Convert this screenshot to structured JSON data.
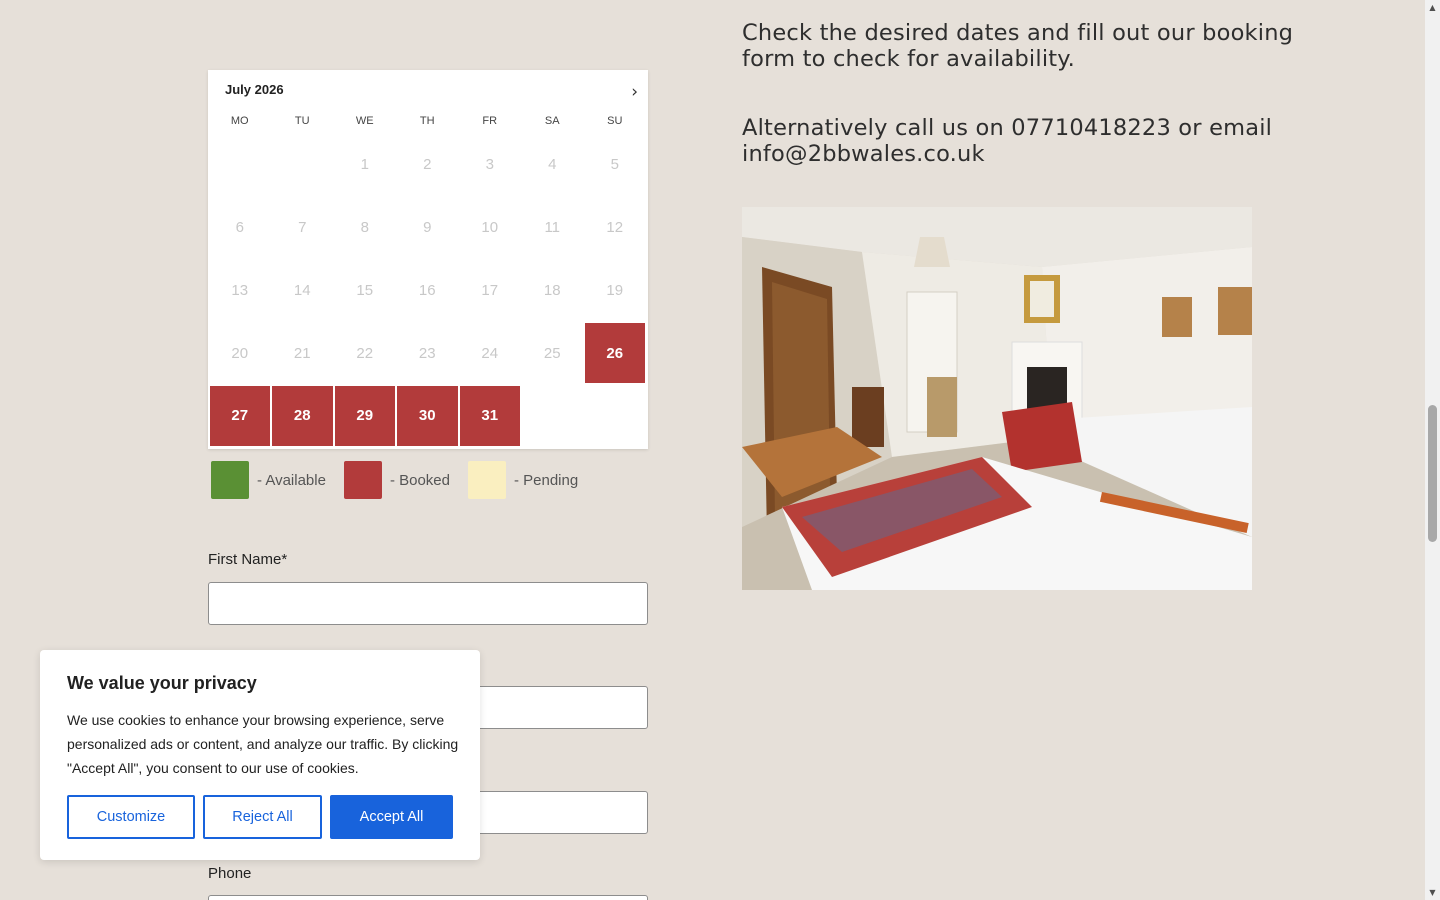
{
  "calendar": {
    "month_label": "July 2026",
    "next_icon": "›",
    "weekdays": [
      "MO",
      "TU",
      "WE",
      "TH",
      "FR",
      "SA",
      "SU"
    ],
    "days": [
      {
        "label": "1",
        "status": "past"
      },
      {
        "label": "2",
        "status": "past"
      },
      {
        "label": "3",
        "status": "past"
      },
      {
        "label": "4",
        "status": "past"
      },
      {
        "label": "5",
        "status": "past"
      },
      {
        "label": "6",
        "status": "past"
      },
      {
        "label": "7",
        "status": "past"
      },
      {
        "label": "8",
        "status": "past"
      },
      {
        "label": "9",
        "status": "past"
      },
      {
        "label": "10",
        "status": "past"
      },
      {
        "label": "11",
        "status": "past"
      },
      {
        "label": "12",
        "status": "past"
      },
      {
        "label": "13",
        "status": "past"
      },
      {
        "label": "14",
        "status": "past"
      },
      {
        "label": "15",
        "status": "past"
      },
      {
        "label": "16",
        "status": "past"
      },
      {
        "label": "17",
        "status": "past"
      },
      {
        "label": "18",
        "status": "past"
      },
      {
        "label": "19",
        "status": "past"
      },
      {
        "label": "20",
        "status": "past"
      },
      {
        "label": "21",
        "status": "past"
      },
      {
        "label": "22",
        "status": "past"
      },
      {
        "label": "23",
        "status": "past"
      },
      {
        "label": "24",
        "status": "past"
      },
      {
        "label": "25",
        "status": "past"
      },
      {
        "label": "26",
        "status": "booked"
      },
      {
        "label": "27",
        "status": "booked"
      },
      {
        "label": "28",
        "status": "booked"
      },
      {
        "label": "29",
        "status": "booked"
      },
      {
        "label": "30",
        "status": "booked"
      },
      {
        "label": "31",
        "status": "booked"
      }
    ],
    "first_weekday_index": 2
  },
  "legend": [
    {
      "label": "- Available",
      "color": "#5a9034"
    },
    {
      "label": "- Booked",
      "color": "#b23b3b"
    },
    {
      "label": "- Pending",
      "color": "#faefc0"
    }
  ],
  "form": {
    "first_name_label": "First Name*",
    "phone_label": "Phone"
  },
  "info": {
    "line1": "Check the desired dates and fill out our booking form to check for availability.",
    "line2": "Alternatively call us on 07710418223 or email info@2bbwales.co.uk"
  },
  "cookie": {
    "title": "We value your privacy",
    "body": "We use cookies to enhance your browsing experience, serve personalized ads or content, and analyze our traffic. By clicking \"Accept All\", you consent to our use of cookies.",
    "customize_label": "Customize",
    "reject_label": "Reject All",
    "accept_label": "Accept All"
  },
  "colors": {
    "booked": "#b23b3b",
    "accent": "#1863dc",
    "background": "#e6e0d9"
  },
  "icons": {
    "photo": "twin-bedroom-photo",
    "next": "chevron-right-icon"
  }
}
